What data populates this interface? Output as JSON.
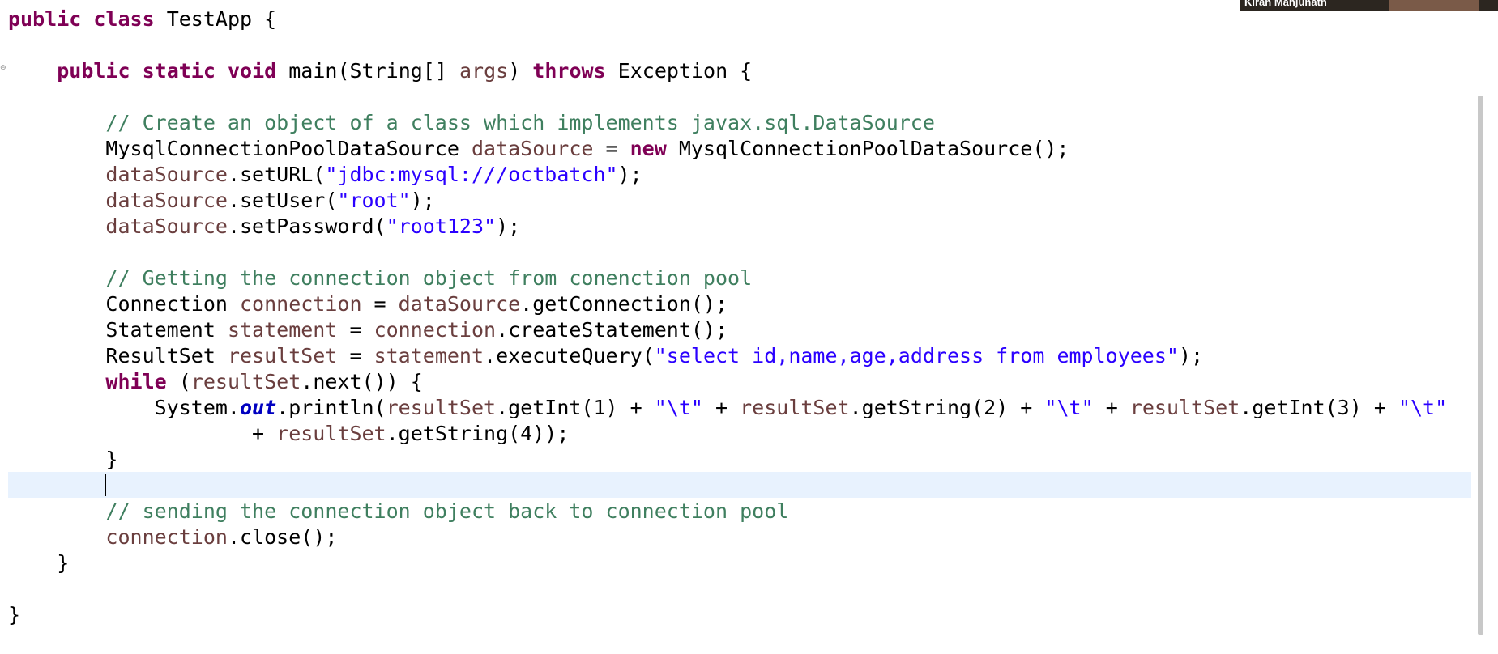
{
  "editor": {
    "lines": [
      {
        "id": "l1",
        "segments": [
          {
            "t": "kw",
            "text": "public"
          },
          {
            "t": "plain",
            "text": " "
          },
          {
            "t": "kw",
            "text": "class"
          },
          {
            "t": "plain",
            "text": " TestApp {"
          }
        ]
      },
      {
        "id": "l3",
        "segments": [
          {
            "t": "plain",
            "text": "    "
          },
          {
            "t": "kw",
            "text": "public"
          },
          {
            "t": "plain",
            "text": " "
          },
          {
            "t": "kw",
            "text": "static"
          },
          {
            "t": "plain",
            "text": " "
          },
          {
            "t": "kw",
            "text": "void"
          },
          {
            "t": "plain",
            "text": " main(String[] "
          },
          {
            "t": "var",
            "text": "args"
          },
          {
            "t": "plain",
            "text": ") "
          },
          {
            "t": "kw",
            "text": "throws"
          },
          {
            "t": "plain",
            "text": " Exception {"
          }
        ]
      },
      {
        "id": "l5",
        "segments": [
          {
            "t": "plain",
            "text": "        "
          },
          {
            "t": "cmt",
            "text": "// Create an object of a class which implements javax.sql.DataSource"
          }
        ]
      },
      {
        "id": "l6",
        "segments": [
          {
            "t": "plain",
            "text": "        MysqlConnectionPoolDataSource "
          },
          {
            "t": "var",
            "text": "dataSource"
          },
          {
            "t": "plain",
            "text": " = "
          },
          {
            "t": "kw",
            "text": "new"
          },
          {
            "t": "plain",
            "text": " MysqlConnectionPoolDataSource();"
          }
        ]
      },
      {
        "id": "l7",
        "segments": [
          {
            "t": "plain",
            "text": "        "
          },
          {
            "t": "var",
            "text": "dataSource"
          },
          {
            "t": "plain",
            "text": ".setURL("
          },
          {
            "t": "str",
            "text": "\"jdbc:mysql:///octbatch\""
          },
          {
            "t": "plain",
            "text": ");"
          }
        ]
      },
      {
        "id": "l8",
        "segments": [
          {
            "t": "plain",
            "text": "        "
          },
          {
            "t": "var",
            "text": "dataSource"
          },
          {
            "t": "plain",
            "text": ".setUser("
          },
          {
            "t": "str",
            "text": "\"root\""
          },
          {
            "t": "plain",
            "text": ");"
          }
        ]
      },
      {
        "id": "l9",
        "segments": [
          {
            "t": "plain",
            "text": "        "
          },
          {
            "t": "var",
            "text": "dataSource"
          },
          {
            "t": "plain",
            "text": ".setPassword("
          },
          {
            "t": "str",
            "text": "\"root123\""
          },
          {
            "t": "plain",
            "text": ");"
          }
        ]
      },
      {
        "id": "l11",
        "segments": [
          {
            "t": "plain",
            "text": "        "
          },
          {
            "t": "cmt",
            "text": "// Getting the connection object from conenction pool"
          }
        ]
      },
      {
        "id": "l12",
        "segments": [
          {
            "t": "plain",
            "text": "        Connection "
          },
          {
            "t": "var",
            "text": "connection"
          },
          {
            "t": "plain",
            "text": " = "
          },
          {
            "t": "var",
            "text": "dataSource"
          },
          {
            "t": "plain",
            "text": ".getConnection();"
          }
        ]
      },
      {
        "id": "l13",
        "segments": [
          {
            "t": "plain",
            "text": "        Statement "
          },
          {
            "t": "var",
            "text": "statement"
          },
          {
            "t": "plain",
            "text": " = "
          },
          {
            "t": "var",
            "text": "connection"
          },
          {
            "t": "plain",
            "text": ".createStatement();"
          }
        ]
      },
      {
        "id": "l14",
        "segments": [
          {
            "t": "plain",
            "text": "        ResultSet "
          },
          {
            "t": "var",
            "text": "resultSet"
          },
          {
            "t": "plain",
            "text": " = "
          },
          {
            "t": "var",
            "text": "statement"
          },
          {
            "t": "plain",
            "text": ".executeQuery("
          },
          {
            "t": "str",
            "text": "\"select id,name,age,address from employees\""
          },
          {
            "t": "plain",
            "text": ");"
          }
        ]
      },
      {
        "id": "l15",
        "segments": [
          {
            "t": "plain",
            "text": "        "
          },
          {
            "t": "kw",
            "text": "while"
          },
          {
            "t": "plain",
            "text": " ("
          },
          {
            "t": "var",
            "text": "resultSet"
          },
          {
            "t": "plain",
            "text": ".next()) {"
          }
        ]
      },
      {
        "id": "l16",
        "segments": [
          {
            "t": "plain",
            "text": "            System."
          },
          {
            "t": "fld",
            "text": "out"
          },
          {
            "t": "plain",
            "text": ".println("
          },
          {
            "t": "var",
            "text": "resultSet"
          },
          {
            "t": "plain",
            "text": ".getInt(1) + "
          },
          {
            "t": "str",
            "text": "\"\\t\""
          },
          {
            "t": "plain",
            "text": " + "
          },
          {
            "t": "var",
            "text": "resultSet"
          },
          {
            "t": "plain",
            "text": ".getString(2) + "
          },
          {
            "t": "str",
            "text": "\"\\t\""
          },
          {
            "t": "plain",
            "text": " + "
          },
          {
            "t": "var",
            "text": "resultSet"
          },
          {
            "t": "plain",
            "text": ".getInt(3) + "
          },
          {
            "t": "str",
            "text": "\"\\t\""
          }
        ]
      },
      {
        "id": "l17",
        "segments": [
          {
            "t": "plain",
            "text": "                    + "
          },
          {
            "t": "var",
            "text": "resultSet"
          },
          {
            "t": "plain",
            "text": ".getString(4));"
          }
        ]
      },
      {
        "id": "l18",
        "segments": [
          {
            "t": "plain",
            "text": "        }"
          }
        ]
      },
      {
        "id": "l20",
        "segments": [
          {
            "t": "plain",
            "text": "        "
          },
          {
            "t": "cmt",
            "text": "// sending the connection object back to connection pool"
          }
        ]
      },
      {
        "id": "l21",
        "segments": [
          {
            "t": "plain",
            "text": "        "
          },
          {
            "t": "var",
            "text": "connection"
          },
          {
            "t": "plain",
            "text": ".close();"
          }
        ]
      },
      {
        "id": "l22",
        "segments": [
          {
            "t": "plain",
            "text": "    }"
          }
        ]
      },
      {
        "id": "l24",
        "segments": [
          {
            "t": "plain",
            "text": "}"
          }
        ]
      }
    ],
    "colors": {
      "keyword": "#7f0055",
      "string": "#2a00ff",
      "comment": "#3f7f5f",
      "local_variable": "#6a3e3e",
      "static_field": "#0000c0",
      "current_line": "#e8f2fe"
    }
  },
  "webcam": {
    "name": "Kiran Manjunath"
  }
}
